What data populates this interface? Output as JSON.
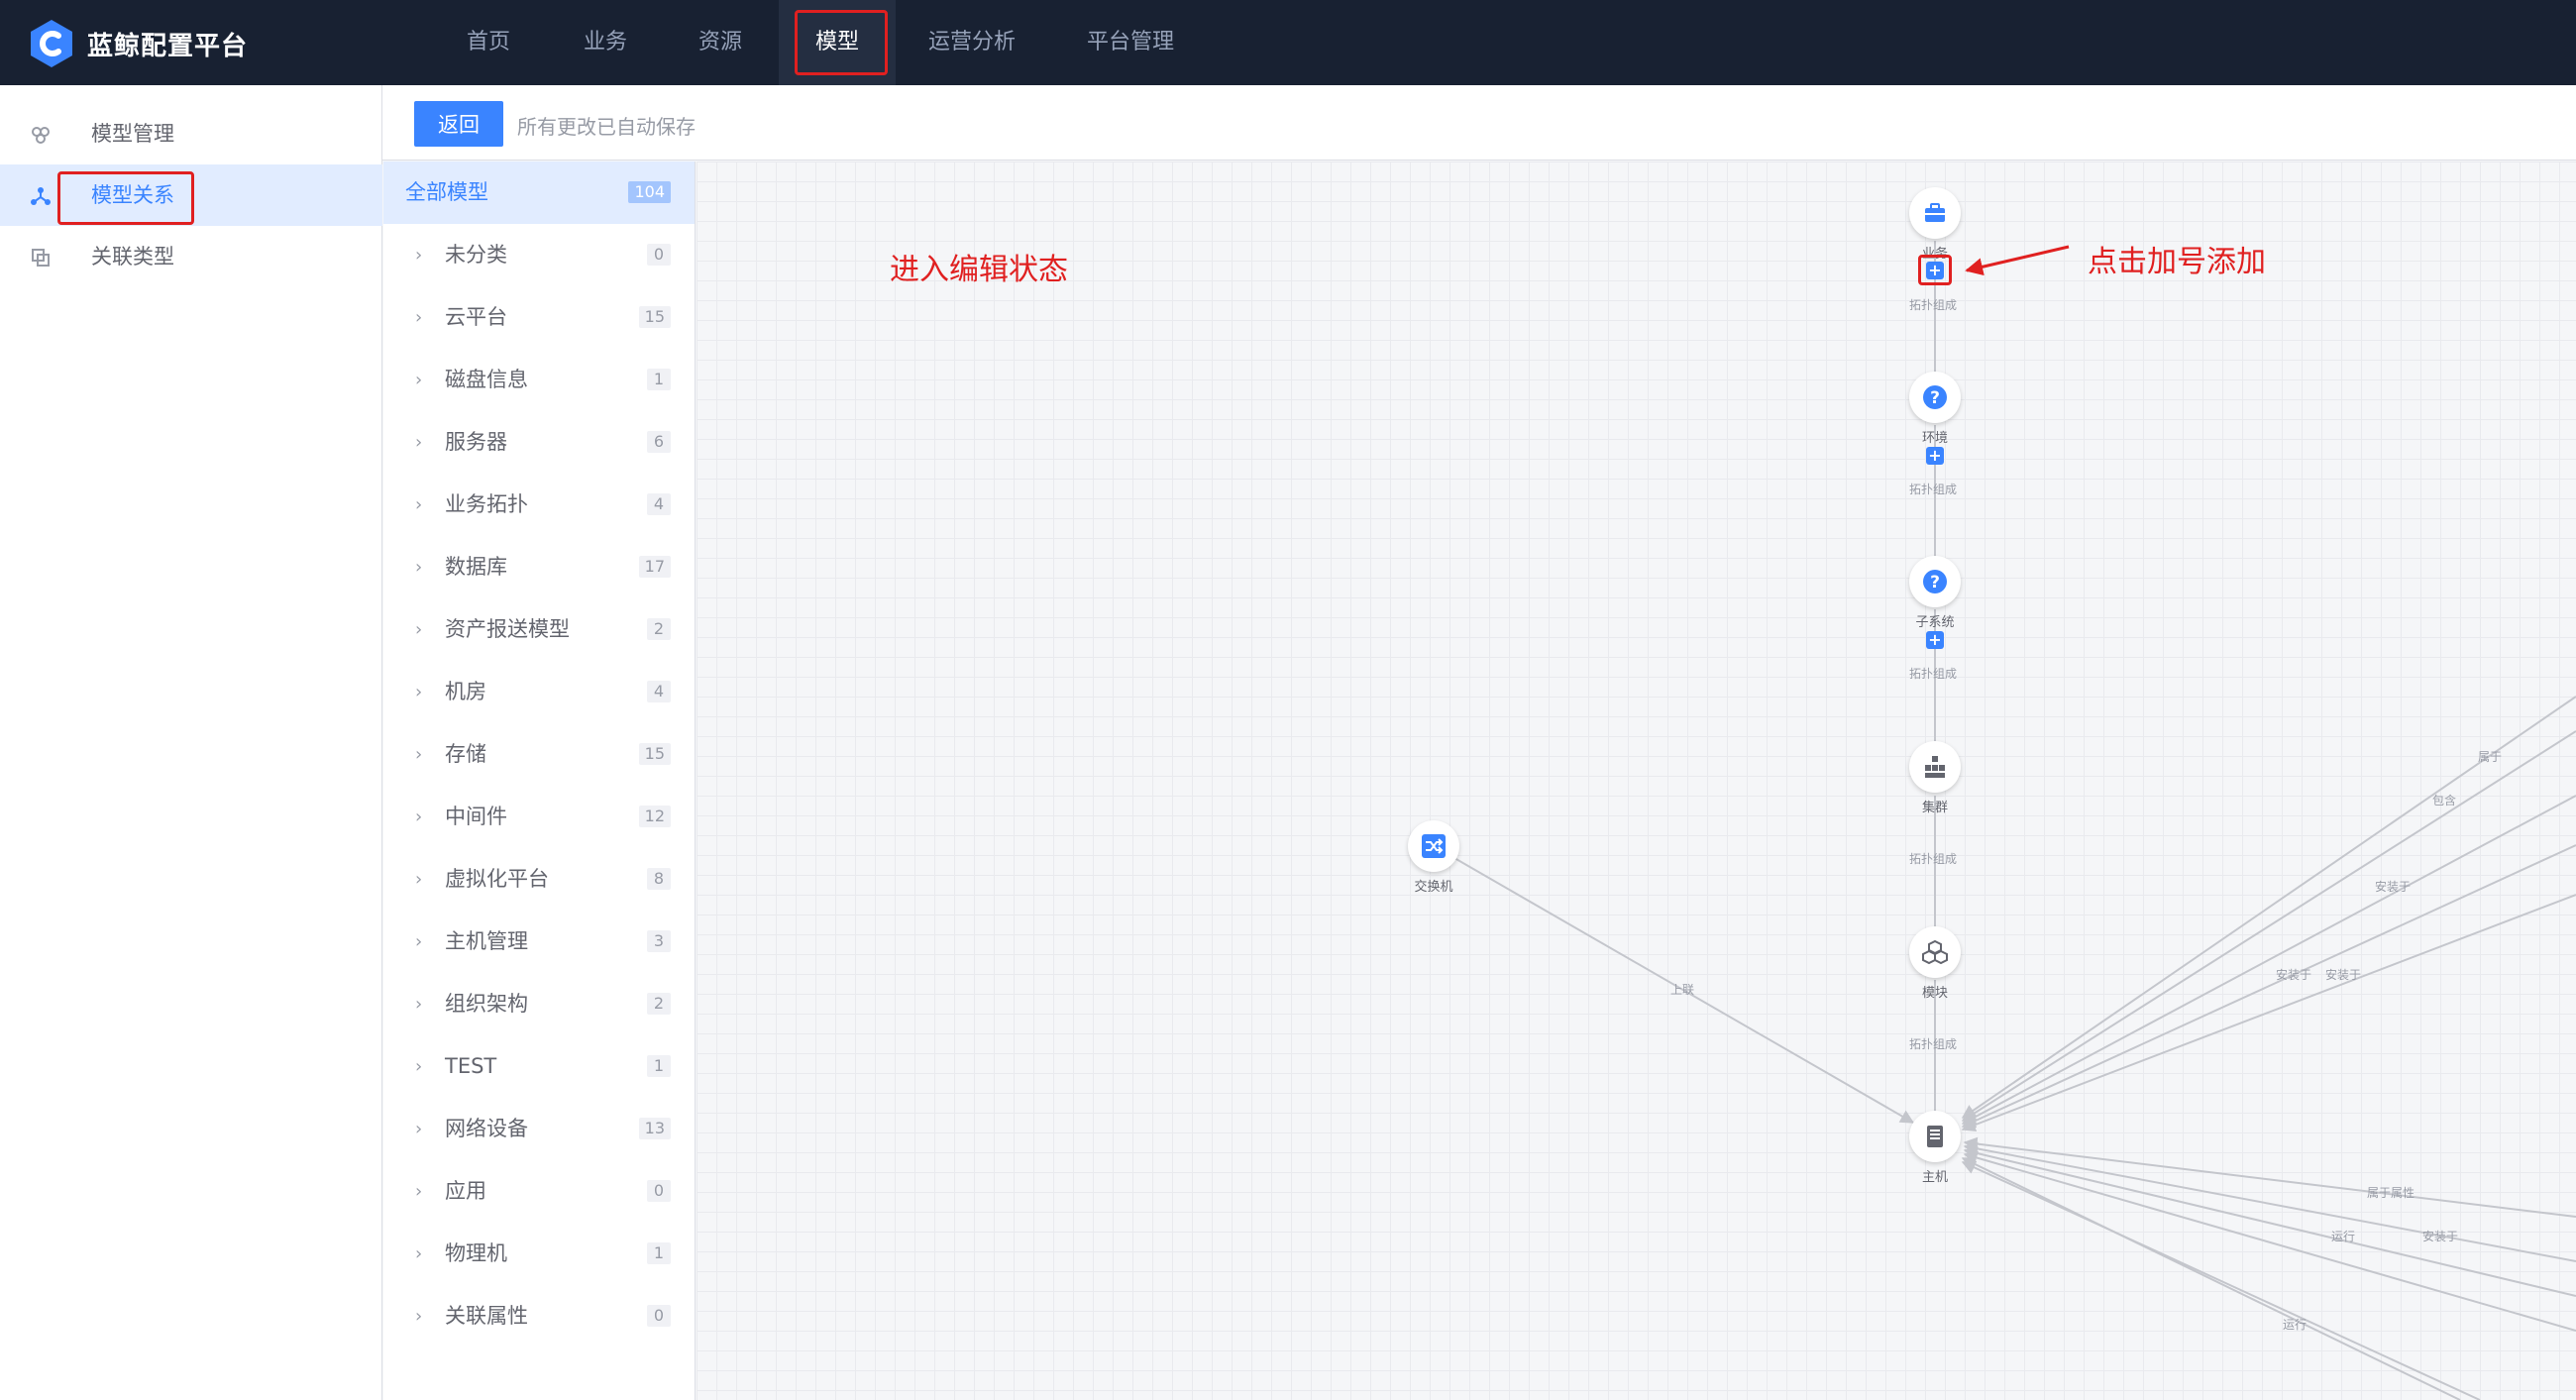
{
  "header": {
    "brand": "蓝鲸配置平台",
    "nav": [
      {
        "label": "首页"
      },
      {
        "label": "业务"
      },
      {
        "label": "资源"
      },
      {
        "label": "模型"
      },
      {
        "label": "运营分析"
      },
      {
        "label": "平台管理"
      }
    ],
    "active_nav": "模型"
  },
  "sidebar": {
    "items": [
      {
        "label": "模型管理",
        "icon": "model-manage-icon"
      },
      {
        "label": "模型关系",
        "icon": "model-relation-icon"
      },
      {
        "label": "关联类型",
        "icon": "relation-type-icon"
      }
    ],
    "active": "模型关系"
  },
  "toolbar": {
    "back_label": "返回",
    "autosave_text": "所有更改已自动保存"
  },
  "model_list": {
    "all": {
      "label": "全部模型",
      "count": "104"
    },
    "groups": [
      {
        "label": "未分类",
        "count": "0"
      },
      {
        "label": "云平台",
        "count": "15"
      },
      {
        "label": "磁盘信息",
        "count": "1"
      },
      {
        "label": "服务器",
        "count": "6"
      },
      {
        "label": "业务拓扑",
        "count": "4"
      },
      {
        "label": "数据库",
        "count": "17"
      },
      {
        "label": "资产报送模型",
        "count": "2"
      },
      {
        "label": "机房",
        "count": "4"
      },
      {
        "label": "存储",
        "count": "15"
      },
      {
        "label": "中间件",
        "count": "12"
      },
      {
        "label": "虚拟化平台",
        "count": "8"
      },
      {
        "label": "主机管理",
        "count": "3"
      },
      {
        "label": "组织架构",
        "count": "2"
      },
      {
        "label": "TEST",
        "count": "1"
      },
      {
        "label": "网络设备",
        "count": "13"
      },
      {
        "label": "应用",
        "count": "0"
      },
      {
        "label": "物理机",
        "count": "1"
      },
      {
        "label": "关联属性",
        "count": "0"
      }
    ]
  },
  "topology": {
    "nodes": {
      "biz": "业务",
      "env": "环境",
      "subsystem": "子系统",
      "cluster": "集群",
      "module": "模块",
      "host": "主机",
      "switch": "交换机"
    },
    "edge_labels": {
      "topo1": "拓扑组成",
      "topo2": "拓扑组成",
      "topo3": "拓扑组成",
      "topo4": "拓扑组成",
      "topo5": "拓扑组成",
      "uplink": "上联",
      "belong1": "属于",
      "contain": "包含",
      "install1": "安装于",
      "install2": "安装于",
      "install3": "安装于",
      "belong_attr": "属于属性",
      "run1": "运行",
      "install4": "安装于",
      "run2": "运行"
    },
    "colors": {
      "accent": "#3a84ff",
      "edge": "#c4c6cc"
    }
  },
  "annotations": {
    "edit_state": "进入编辑状态",
    "click_plus": "点击加号添加"
  }
}
